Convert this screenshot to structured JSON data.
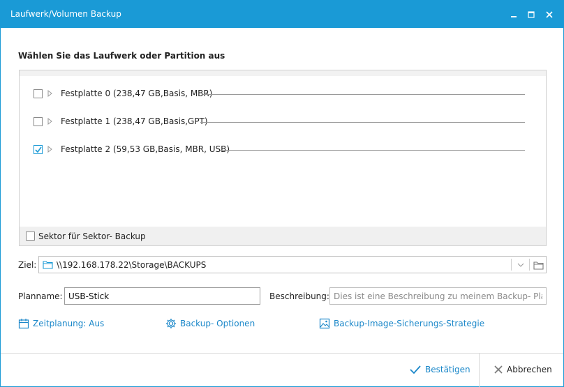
{
  "window": {
    "title": "Laufwerk/Volumen Backup"
  },
  "section_title": "Wählen Sie das Laufwerk oder Partition aus",
  "disks": [
    {
      "label": "Festplatte 0 (238,47 GB,Basis, MBR)",
      "checked": false
    },
    {
      "label": "Festplatte 1 (238,47 GB,Basis,GPT)",
      "checked": false
    },
    {
      "label": "Festplatte 2 (59,53 GB,Basis, MBR, USB)",
      "checked": true
    }
  ],
  "sector_backup": {
    "label": "Sektor für Sektor- Backup",
    "checked": false
  },
  "ziel": {
    "label": "Ziel:",
    "path": "\\\\192.168.178.22\\Storage\\BACKUPS"
  },
  "planname": {
    "label": "Planname:",
    "value": "USB-Stick"
  },
  "beschreibung": {
    "label": "Beschreibung:",
    "placeholder": "Dies ist eine Beschreibung zu meinem Backup- Plan."
  },
  "links": {
    "zeitplanung": "Zeitplanung: Aus",
    "backup_optionen": "Backup- Optionen",
    "strategie": "Backup-Image-Sicherungs-Strategie"
  },
  "footer": {
    "confirm": "Bestätigen",
    "cancel": "Abbrechen"
  },
  "colors": {
    "accent": "#1a9ad6",
    "link": "#1a87c9"
  }
}
